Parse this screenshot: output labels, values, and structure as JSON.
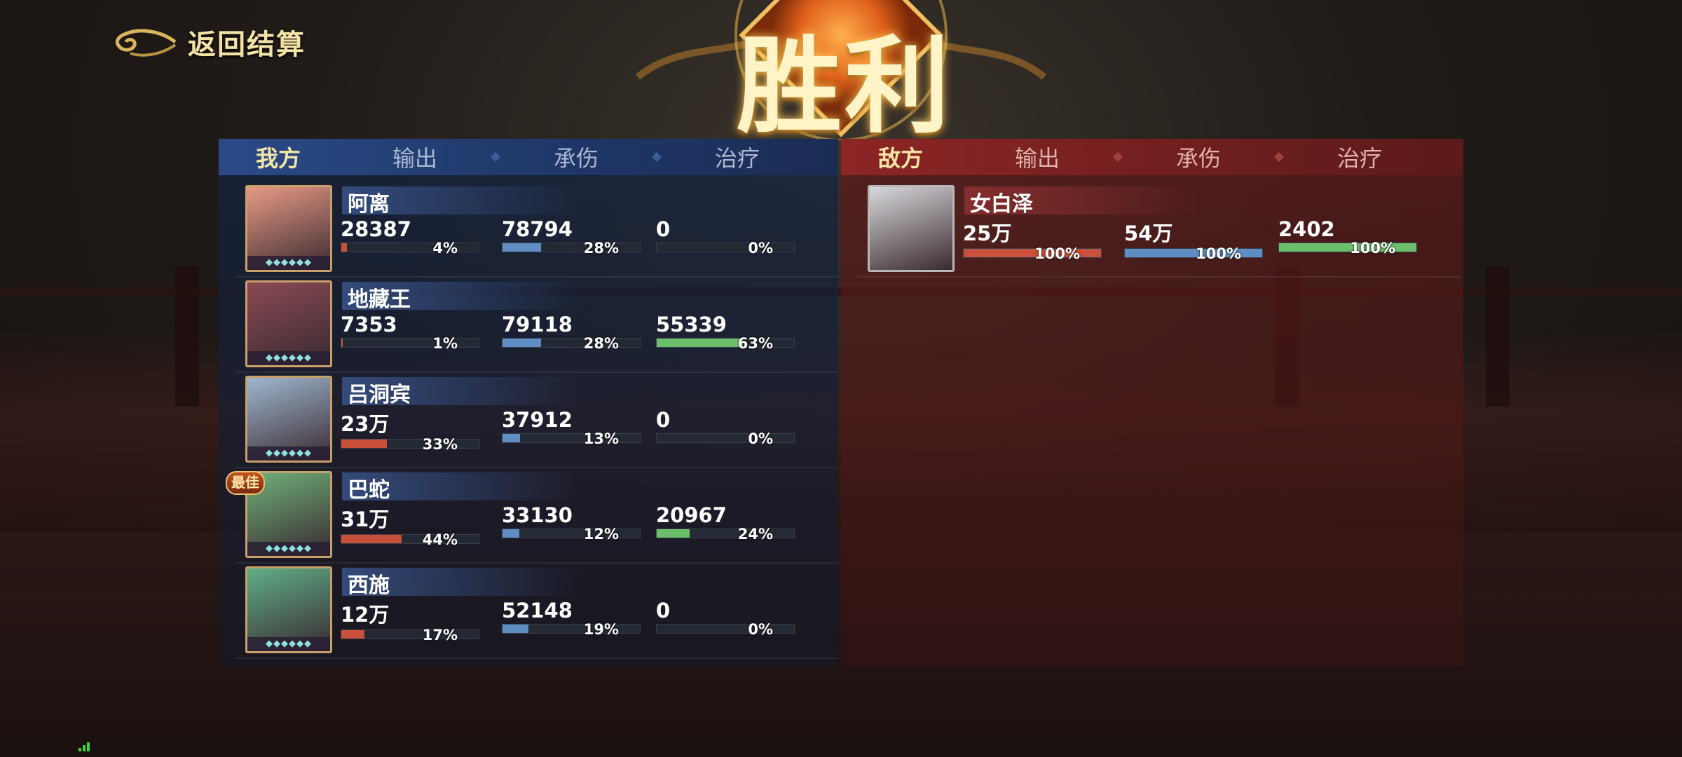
{
  "header": {
    "back_label": "返回结算",
    "victory_title": "胜利"
  },
  "ally": {
    "side_label": "我方",
    "tabs": [
      "输出",
      "承伤",
      "治疗"
    ],
    "heroes": [
      {
        "name": "阿离",
        "output": "28387",
        "output_pct": "4%",
        "output_frac": 0.04,
        "taken": "78794",
        "taken_pct": "28%",
        "taken_frac": 0.28,
        "heal": "0",
        "heal_pct": "0%",
        "heal_frac": 0,
        "best": false,
        "portrait_color": "#e89a86"
      },
      {
        "name": "地藏王",
        "output": "7353",
        "output_pct": "1%",
        "output_frac": 0.01,
        "taken": "79118",
        "taken_pct": "28%",
        "taken_frac": 0.28,
        "heal": "55339",
        "heal_pct": "63%",
        "heal_frac": 0.63,
        "best": false,
        "portrait_color": "#8a4a55"
      },
      {
        "name": "吕洞宾",
        "output": "23万",
        "output_pct": "33%",
        "output_frac": 0.33,
        "taken": "37912",
        "taken_pct": "13%",
        "taken_frac": 0.13,
        "heal": "0",
        "heal_pct": "0%",
        "heal_frac": 0,
        "best": false,
        "portrait_color": "#9fb7d0"
      },
      {
        "name": "巴蛇",
        "output": "31万",
        "output_pct": "44%",
        "output_frac": 0.44,
        "taken": "33130",
        "taken_pct": "12%",
        "taken_frac": 0.12,
        "heal": "20967",
        "heal_pct": "24%",
        "heal_frac": 0.24,
        "best": true,
        "best_label": "最佳",
        "portrait_color": "#6fb07a"
      },
      {
        "name": "西施",
        "output": "12万",
        "output_pct": "17%",
        "output_frac": 0.17,
        "taken": "52148",
        "taken_pct": "19%",
        "taken_frac": 0.19,
        "heal": "0",
        "heal_pct": "0%",
        "heal_frac": 0,
        "best": false,
        "portrait_color": "#5fae88"
      }
    ]
  },
  "enemy": {
    "side_label": "敌方",
    "tabs": [
      "输出",
      "承伤",
      "治疗"
    ],
    "heroes": [
      {
        "name": "女白泽",
        "output": "25万",
        "output_pct": "100%",
        "output_frac": 1,
        "taken": "54万",
        "taken_pct": "100%",
        "taken_frac": 1,
        "heal": "2402",
        "heal_pct": "100%",
        "heal_frac": 1,
        "portrait_color": "#d8d8dc"
      }
    ]
  },
  "colors": {
    "output": "#c9503a",
    "taken": "#5e8ec4",
    "heal": "#6cbf6a",
    "gold": "#f4e3a6"
  },
  "icons": [
    "back-cloud-icon",
    "victory-sun-icon",
    "signal-icon",
    "star-rank-icon"
  ]
}
